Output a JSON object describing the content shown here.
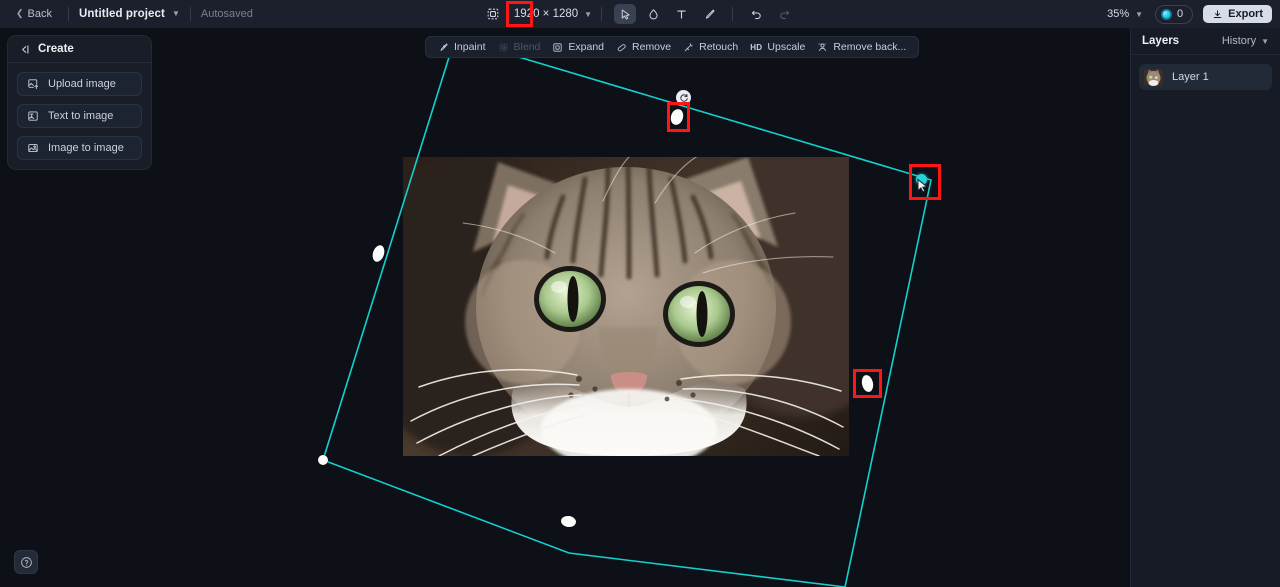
{
  "header": {
    "back_label": "Back",
    "project_name": "Untitled project",
    "autosave_status": "Autosaved",
    "canvas_size_icon": "canvas-resize-icon",
    "dimensions": "1920 × 1280",
    "tools": [
      {
        "name": "select-tool",
        "icon": "cursor-arrow-icon",
        "active": true
      },
      {
        "name": "shape-tool",
        "icon": "blob-shape-icon",
        "active": false
      },
      {
        "name": "text-tool",
        "icon": "text-T-icon",
        "active": false
      },
      {
        "name": "brush-tool",
        "icon": "paintbrush-icon",
        "active": false
      }
    ],
    "undo_icon": "undo-arrow-icon",
    "redo_icon": "redo-arrow-icon",
    "zoom_level": "35%",
    "credits_count": "0",
    "credits_icon": "credit-coin-icon",
    "export_label": "Export",
    "export_icon": "download-icon"
  },
  "create_panel": {
    "title": "Create",
    "collapse_icon": "collapse-panel-icon",
    "items": [
      {
        "label": "Upload image",
        "icon": "upload-image-icon"
      },
      {
        "label": "Text to image",
        "icon": "text-to-image-icon"
      },
      {
        "label": "Image to image",
        "icon": "image-to-image-icon"
      }
    ]
  },
  "context_toolbar": {
    "items": [
      {
        "label": "Inpaint",
        "icon": "inpaint-brush-icon",
        "disabled": false
      },
      {
        "label": "Blend",
        "icon": "blend-icon",
        "disabled": true
      },
      {
        "label": "Expand",
        "icon": "expand-frame-icon",
        "disabled": false
      },
      {
        "label": "Remove",
        "icon": "eraser-icon",
        "disabled": false
      },
      {
        "label": "Retouch",
        "icon": "retouch-wand-icon",
        "disabled": false
      },
      {
        "label": "Upscale",
        "icon": "hd-icon",
        "badge": "HD",
        "disabled": false
      },
      {
        "label": "Remove back...",
        "icon": "remove-background-icon",
        "disabled": false
      }
    ]
  },
  "layers_panel": {
    "title": "Layers",
    "history_label": "History",
    "history_chevron_icon": "chevron-down-icon",
    "layers": [
      {
        "name": "Layer 1",
        "thumbnail": "cat-thumbnail"
      }
    ]
  },
  "canvas": {
    "help_label": "?",
    "help_icon": "help-question-icon",
    "selection_color": "#12d1cf",
    "annotation_color": "#fe1616",
    "image_subject": "close-up tabby cat face",
    "rotate_icon": "rotate-handle-icon",
    "cursor_icon": "pointer-cursor-icon",
    "annotations": [
      {
        "name": "top-edge-handle-highlight"
      },
      {
        "name": "right-corner-handle-highlight"
      },
      {
        "name": "right-edge-handle-highlight"
      },
      {
        "name": "toolbar-canvas-size-highlight"
      }
    ]
  }
}
